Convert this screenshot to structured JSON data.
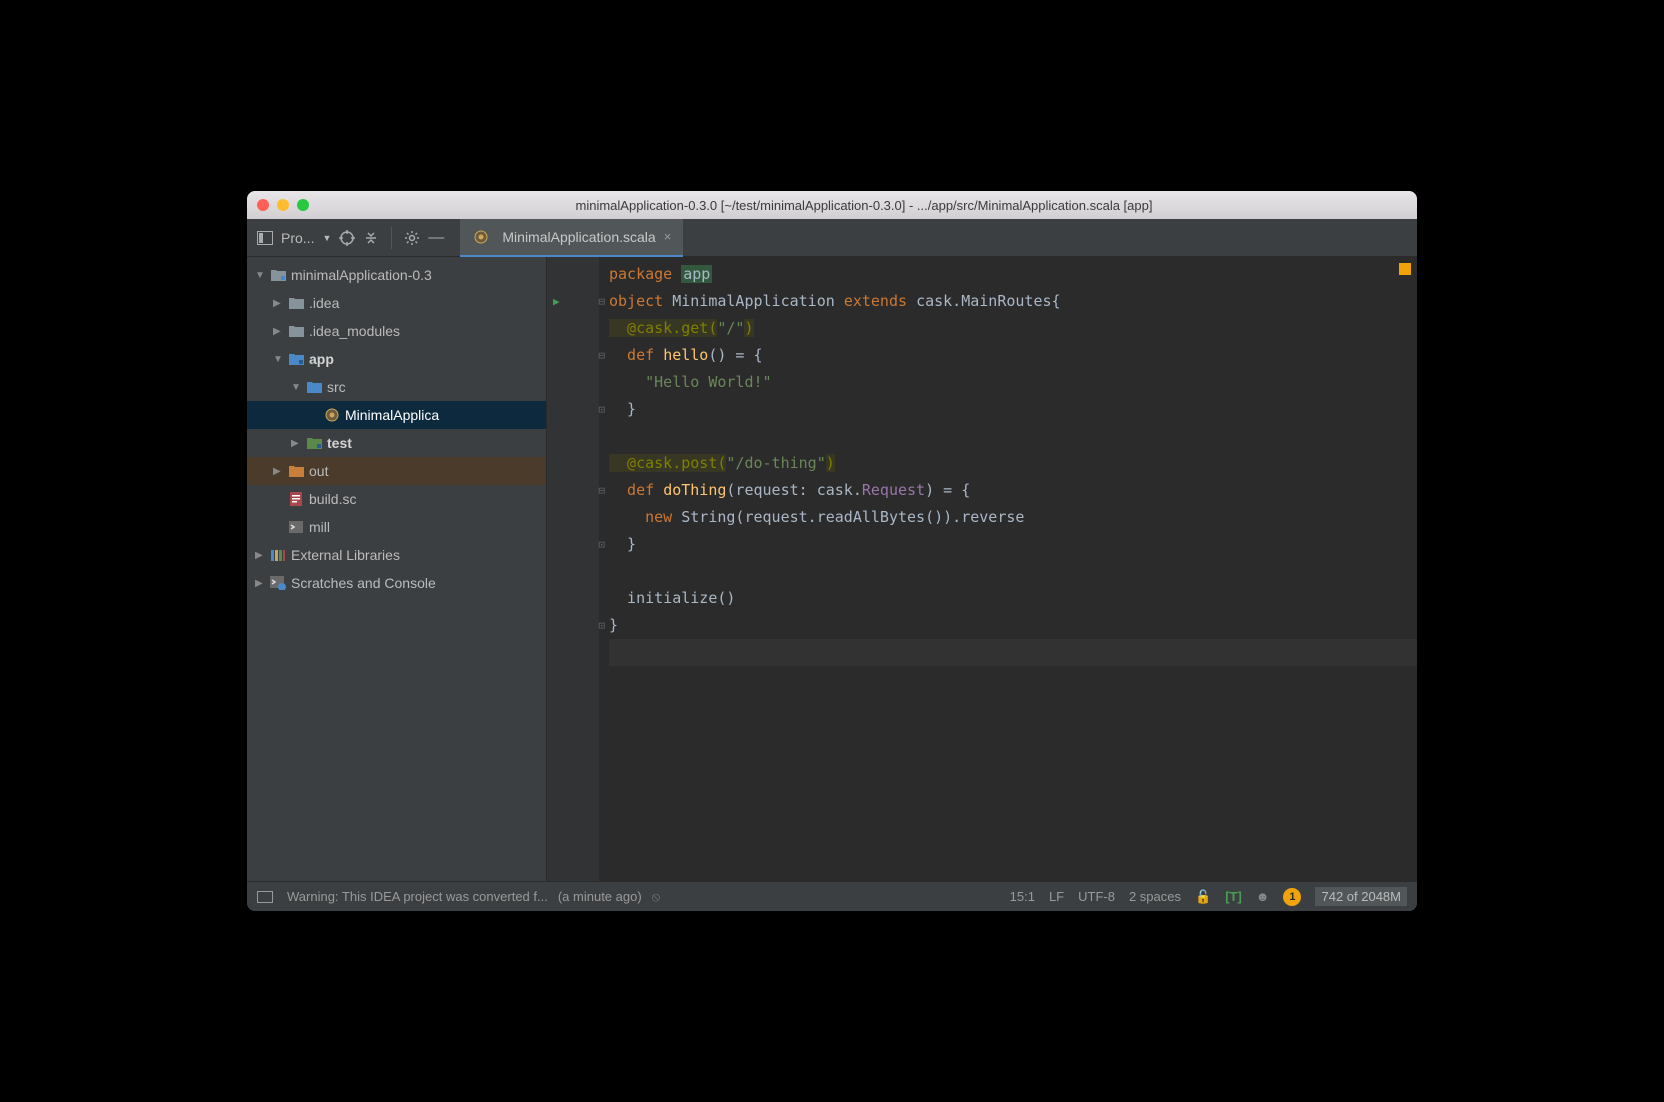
{
  "title": "minimalApplication-0.3.0 [~/test/minimalApplication-0.3.0] - .../app/src/MinimalApplication.scala [app]",
  "projectTool": {
    "label": "Pro..."
  },
  "tab": {
    "name": "MinimalApplication.scala"
  },
  "tree": {
    "root": "minimalApplication-0.3",
    "idea": ".idea",
    "ideaModules": ".idea_modules",
    "app": "app",
    "src": "src",
    "file": "MinimalApplica",
    "test": "test",
    "out": "out",
    "buildsc": "build.sc",
    "mill": "mill",
    "external": "External Libraries",
    "scratches": "Scratches and Console"
  },
  "code": {
    "l1_package": "package",
    "l1_app": "app",
    "l2_object": "object",
    "l2_name": "MinimalApplication",
    "l2_extends": "extends",
    "l2_parent": "cask.MainRoutes{",
    "l3": "  @cask.get(",
    "l3_str": "\"/\"",
    "l3_end": ")",
    "l4_def": "  def",
    "l4_name": "hello",
    "l4_rest": "() = {",
    "l5": "    ",
    "l5_str": "\"Hello World!\"",
    "l6": "  }",
    "l8": "  @cask.post(",
    "l8_str": "\"/do-thing\"",
    "l8_end": ")",
    "l9_def": "  def",
    "l9_name": "doThing",
    "l9_paren": "(request: cask.",
    "l9_req": "Request",
    "l9_rest": ") = {",
    "l10_new": "    new",
    "l10_rest": " String(request.readAllBytes()).reverse",
    "l11": "  }",
    "l13": "  initialize()",
    "l14": "}"
  },
  "status": {
    "warning": "Warning: This IDEA project was converted f...",
    "time": "(a minute ago)",
    "pos": "15:1",
    "lf": "LF",
    "enc": "UTF-8",
    "indent": "2 spaces",
    "t": "[T]",
    "badge": "1",
    "mem": "742 of 2048M"
  }
}
